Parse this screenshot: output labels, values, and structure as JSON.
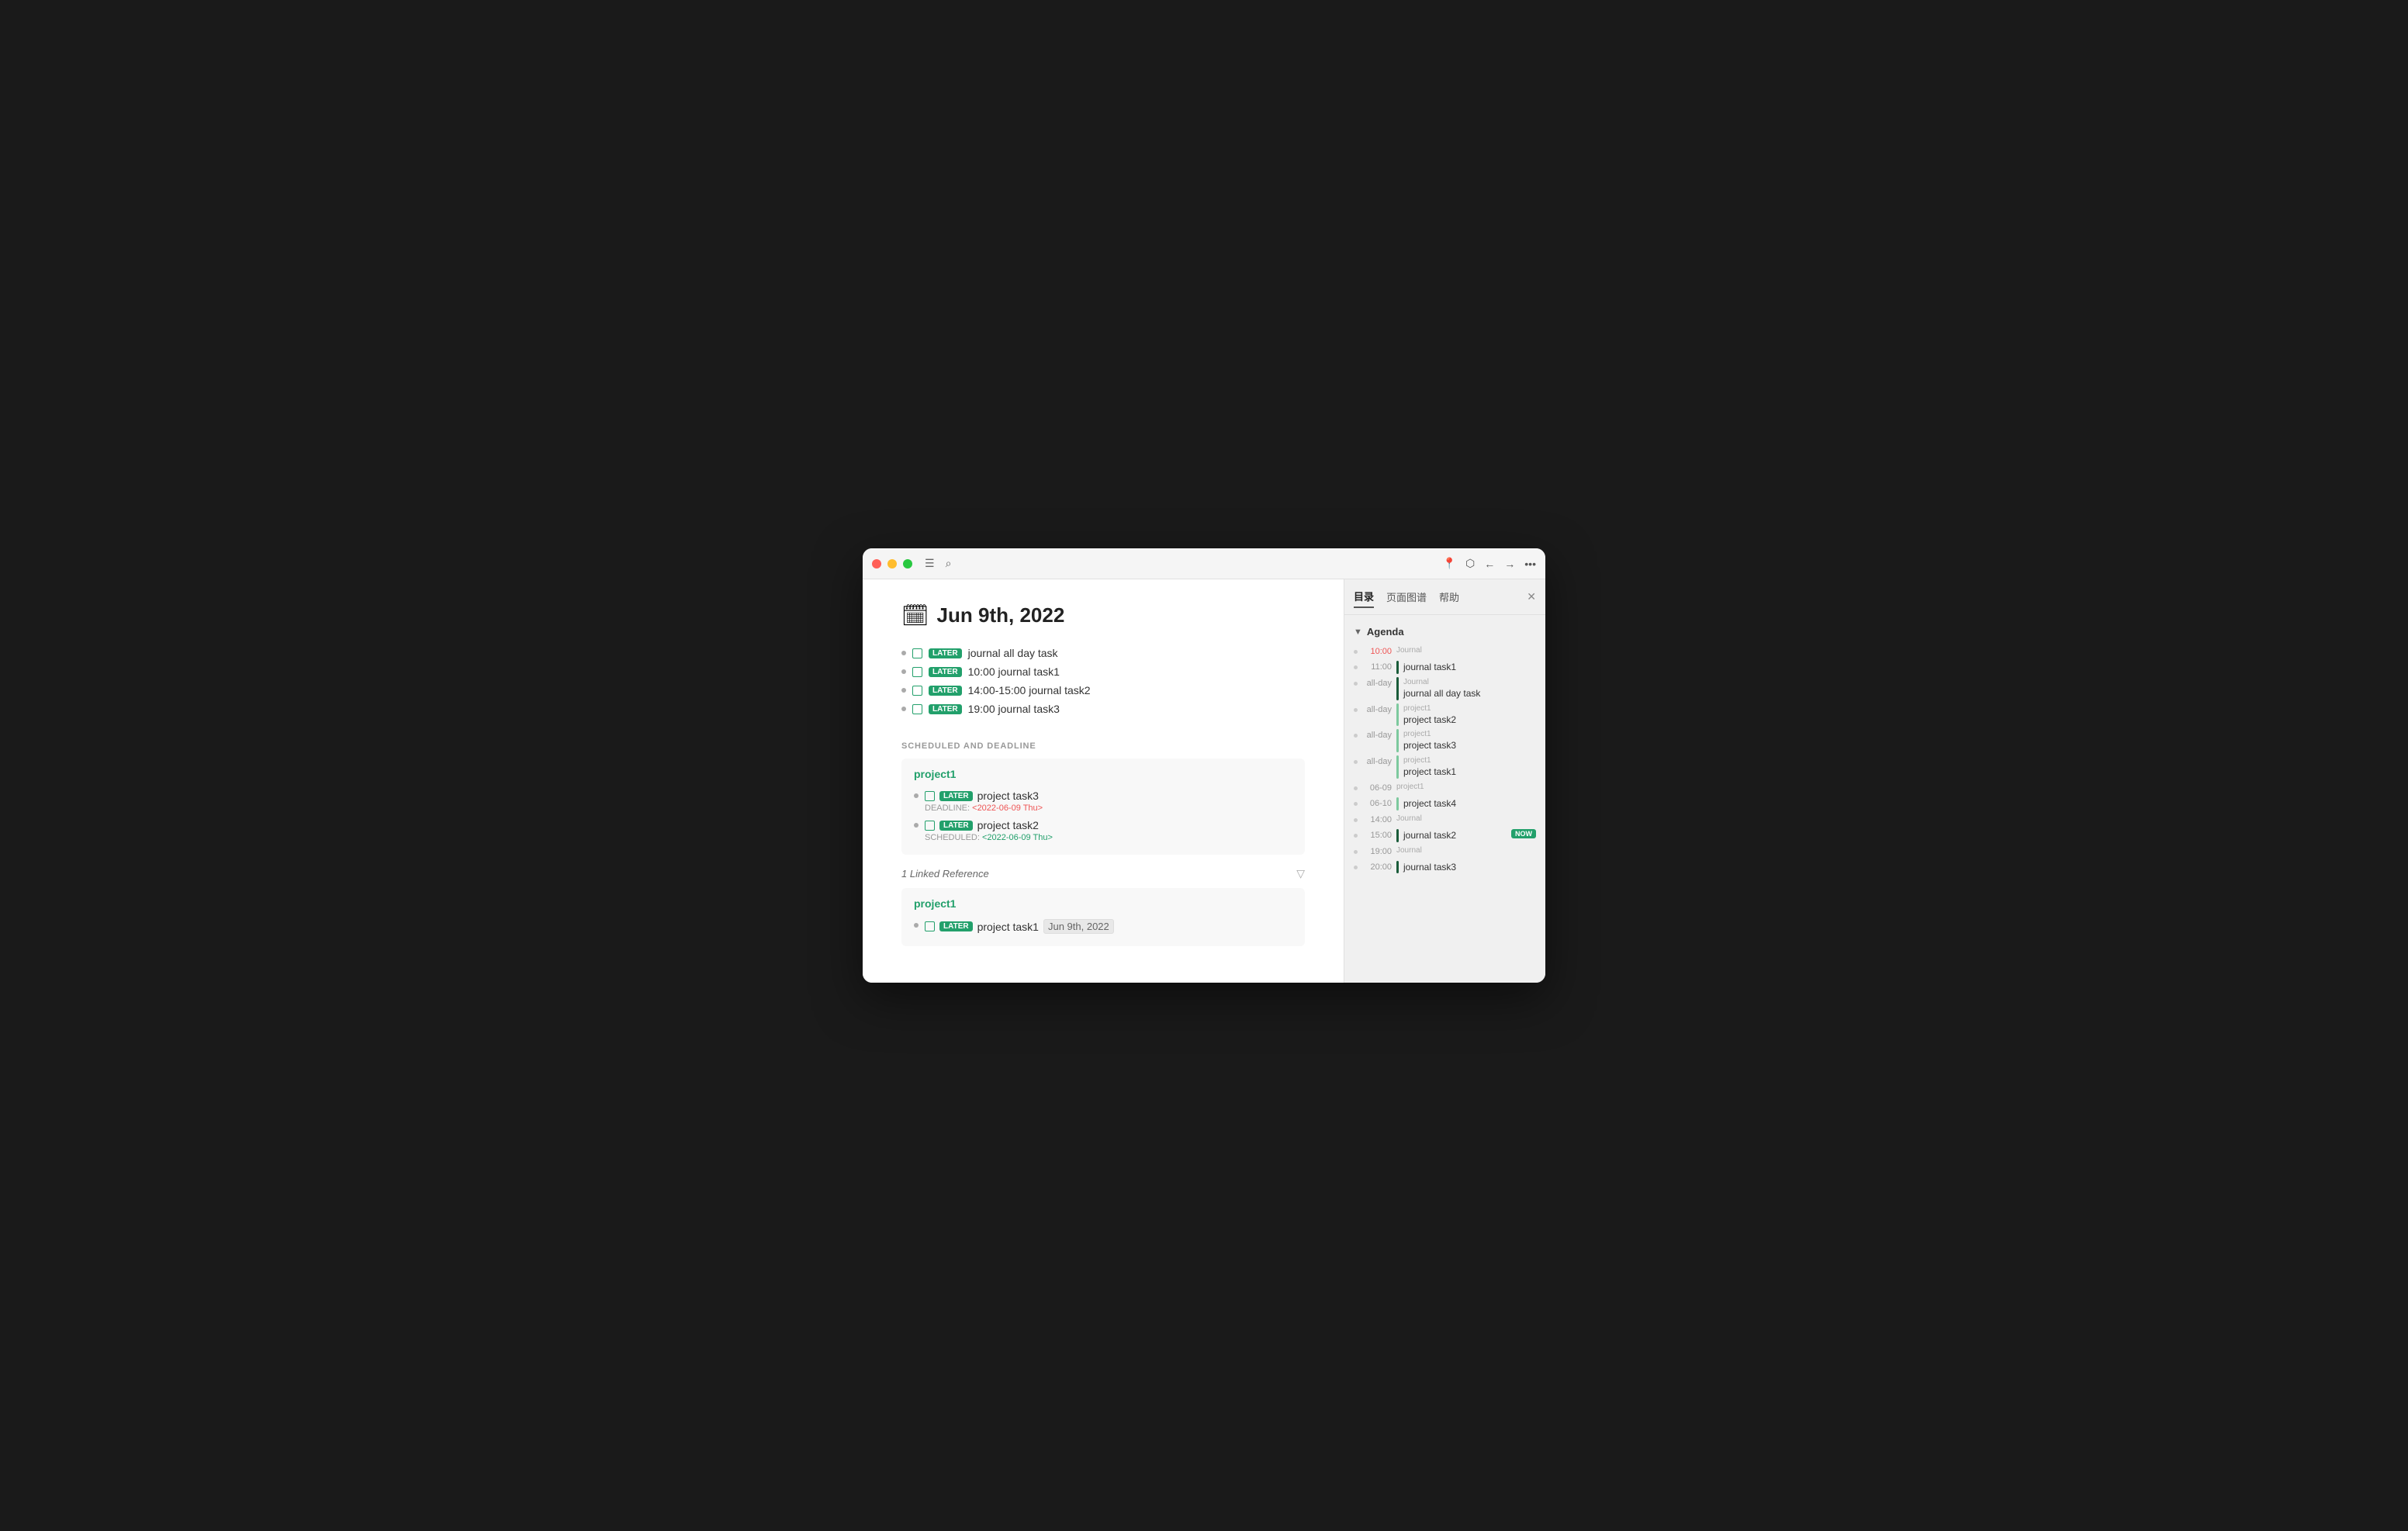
{
  "window": {
    "title": "Jun 9th, 2022"
  },
  "titlebar": {
    "traffic_lights": [
      "red",
      "yellow",
      "green"
    ],
    "left_icons": [
      "hamburger",
      "search"
    ],
    "right_icons": [
      "pin",
      "graph",
      "back",
      "forward",
      "more"
    ],
    "sidebar_toggle": "sidebar-icon"
  },
  "right_panel": {
    "tabs": [
      "目录",
      "页面图谱",
      "帮助"
    ],
    "active_tab": "目录",
    "close_icon": "×",
    "agenda_section": {
      "title": "Agenda",
      "items": [
        {
          "time": "10:00",
          "time_color": "red",
          "source": "Journal",
          "task": "",
          "bar_color": "none"
        },
        {
          "time": "11:00",
          "time_color": "normal",
          "source": "",
          "task": "journal task1",
          "bar_color": "dark"
        },
        {
          "time": "all-day",
          "time_color": "normal",
          "source": "Journal",
          "task": "journal all day task",
          "bar_color": "dark"
        },
        {
          "time": "all-day",
          "time_color": "normal",
          "source": "project1",
          "task": "project task2",
          "bar_color": "light"
        },
        {
          "time": "all-day",
          "time_color": "normal",
          "source": "project1",
          "task": "project task3",
          "bar_color": "light"
        },
        {
          "time": "all-day",
          "time_color": "normal",
          "source": "project1",
          "task": "project task1",
          "bar_color": "light"
        },
        {
          "time": "06-09",
          "time_color": "normal",
          "source": "project1",
          "task": "",
          "bar_color": "none"
        },
        {
          "time": "06-10",
          "time_color": "normal",
          "source": "",
          "task": "project task4",
          "bar_color": "light"
        },
        {
          "time": "14:00",
          "time_color": "normal",
          "source": "Journal",
          "task": "",
          "bar_color": "none"
        },
        {
          "time": "15:00",
          "time_color": "normal",
          "source": "",
          "task": "journal task2",
          "bar_color": "dark",
          "badge": "NOW"
        },
        {
          "time": "19:00",
          "time_color": "normal",
          "source": "Journal",
          "task": "",
          "bar_color": "none"
        },
        {
          "time": "20:00",
          "time_color": "normal",
          "source": "",
          "task": "journal task3",
          "bar_color": "dark"
        }
      ]
    }
  },
  "main": {
    "page_icon": "🗓",
    "page_title": "Jun 9th, 2022",
    "tasks": [
      {
        "badge": "LATER",
        "text": "journal all day task"
      },
      {
        "badge": "LATER",
        "text": "10:00 journal task1"
      },
      {
        "badge": "LATER",
        "text": "14:00-15:00 journal task2"
      },
      {
        "badge": "LATER",
        "text": "19:00 journal task3"
      }
    ],
    "scheduled_section": {
      "header": "SCHEDULED AND DEADLINE",
      "cards": [
        {
          "title": "project1",
          "tasks": [
            {
              "badge": "LATER",
              "text": "project task3",
              "meta_label": "DEADLINE:",
              "meta_date": "<2022-06-09 Thu>",
              "meta_type": "deadline"
            },
            {
              "badge": "LATER",
              "text": "project task2",
              "meta_label": "SCHEDULED:",
              "meta_date": "<2022-06-09 Thu>",
              "meta_type": "scheduled"
            }
          ]
        }
      ]
    },
    "linked_ref_section": {
      "header": "1 Linked Reference",
      "cards": [
        {
          "title": "project1",
          "tasks": [
            {
              "badge": "LATER",
              "text": "project task1",
              "date_link": "Jun 9th, 2022"
            }
          ]
        }
      ]
    }
  }
}
